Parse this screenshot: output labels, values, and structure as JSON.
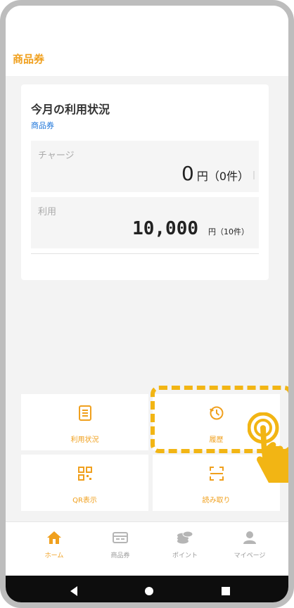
{
  "header": {
    "title": "商品券"
  },
  "summary": {
    "title": "今月の利用状況",
    "subtitle": "商品券",
    "charge": {
      "label": "チャージ",
      "amount": "0",
      "unit": "円（0件）"
    },
    "use": {
      "label": "利用",
      "amount": "10,000",
      "unit": "円（10件）"
    }
  },
  "tiles": [
    {
      "label": "利用状況",
      "icon": "list-icon"
    },
    {
      "label": "履歴",
      "icon": "history-clock-icon"
    },
    {
      "label": "QR表示",
      "icon": "qr-code-icon"
    },
    {
      "label": "読み取り",
      "icon": "scan-frame-icon"
    }
  ],
  "nav": [
    {
      "label": "ホーム",
      "icon": "home-icon",
      "active": true
    },
    {
      "label": "商品券",
      "icon": "voucher-card-icon",
      "active": false
    },
    {
      "label": "ポイント",
      "icon": "coins-icon",
      "active": false
    },
    {
      "label": "マイページ",
      "icon": "user-icon",
      "active": false
    }
  ],
  "colors": {
    "accent": "#f0a01e",
    "link": "#1a73d9",
    "highlight": "#f2b514"
  }
}
